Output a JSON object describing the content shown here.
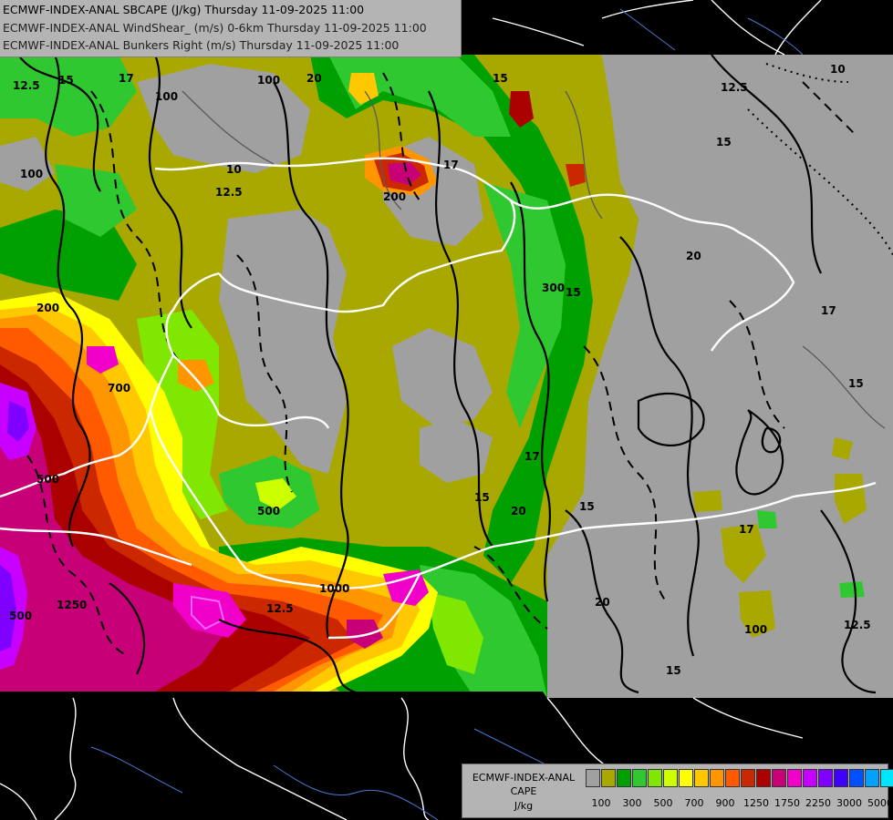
{
  "title": {
    "line1": "ECMWF-INDEX-ANAL SBCAPE (J/kg) Thursday 11-09-2025 11:00",
    "line2": "ECMWF-INDEX-ANAL WindShear_ (m/s) 0-6km Thursday 11-09-2025 11:00",
    "line3": "ECMWF-INDEX-ANAL Bunkers Right (m/s) Thursday 11-09-2025 11:00"
  },
  "legend": {
    "line1": "ECMWF-INDEX-ANAL",
    "line2": "CAPE",
    "line3": "J/kg",
    "colors": [
      "#a0a0a0",
      "#a8a800",
      "#00a000",
      "#30c830",
      "#80e800",
      "#ccff00",
      "#ffff00",
      "#ffc800",
      "#ff9600",
      "#ff5a00",
      "#cc2800",
      "#aa0000",
      "#c80078",
      "#f000c8",
      "#c800ff",
      "#8000ff",
      "#4000ff",
      "#0050ff",
      "#00a0ff",
      "#00e6ff",
      "#80ffff",
      "#ffffff"
    ],
    "ticks": [
      "100",
      "300",
      "500",
      "700",
      "900",
      "1250",
      "1750",
      "2250",
      "3000",
      "5000"
    ]
  },
  "contour_labels": [
    "12.5",
    "15",
    "17",
    "100",
    "10",
    "20",
    "100",
    "17",
    "15",
    "12.5",
    "15",
    "200",
    "100",
    "300",
    "700",
    "500",
    "500",
    "1250",
    "1000",
    "500",
    "200",
    "15",
    "20",
    "17",
    "12.5",
    "100",
    "15",
    "10",
    "12.5",
    "20",
    "15",
    "17",
    "20",
    "12.5",
    "15",
    "17",
    "15"
  ]
}
